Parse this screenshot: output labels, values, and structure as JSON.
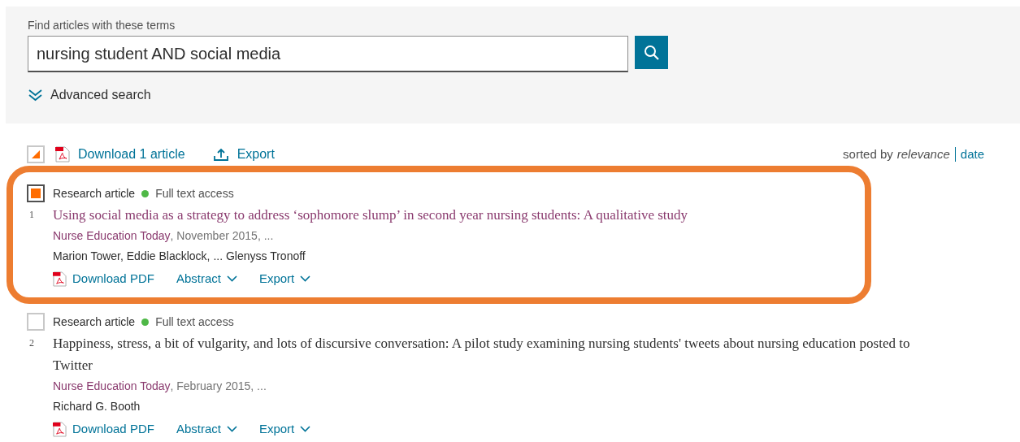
{
  "search": {
    "label": "Find articles with these terms",
    "value": "nursing student AND social media",
    "advanced": "Advanced search"
  },
  "toolbar": {
    "select_all": {
      "partial": true
    },
    "download": "Download 1 article",
    "export": "Export",
    "sort_label": "sorted by",
    "sort_options": [
      {
        "label": "relevance",
        "selected": true
      },
      {
        "label": "date",
        "selected": false
      }
    ]
  },
  "results": [
    {
      "selected": true,
      "highlighted": true,
      "visited": true,
      "type": "Research article",
      "access": "Full text access",
      "number": "1",
      "title": "Using social media as a strategy to address ‘sophomore slump’ in second year nursing students: A qualitative study",
      "journal": "Nurse Education Today",
      "date": ", November 2015, ...",
      "authors": "Marion Tower, Eddie Blacklock, ... Glenyss Tronoff",
      "actions": [
        "Download PDF",
        "Abstract",
        "Export"
      ]
    },
    {
      "selected": false,
      "highlighted": false,
      "visited": false,
      "type": "Research article",
      "access": "Full text access",
      "number": "2",
      "title": "Happiness, stress, a bit of vulgarity, and lots of discursive conversation: A pilot study examining nursing students' tweets about nursing education posted to Twitter",
      "journal": "Nurse Education Today",
      "date": ", February 2015, ...",
      "authors": "Richard G. Booth",
      "actions": [
        "Download PDF",
        "Abstract",
        "Export"
      ]
    }
  ]
}
